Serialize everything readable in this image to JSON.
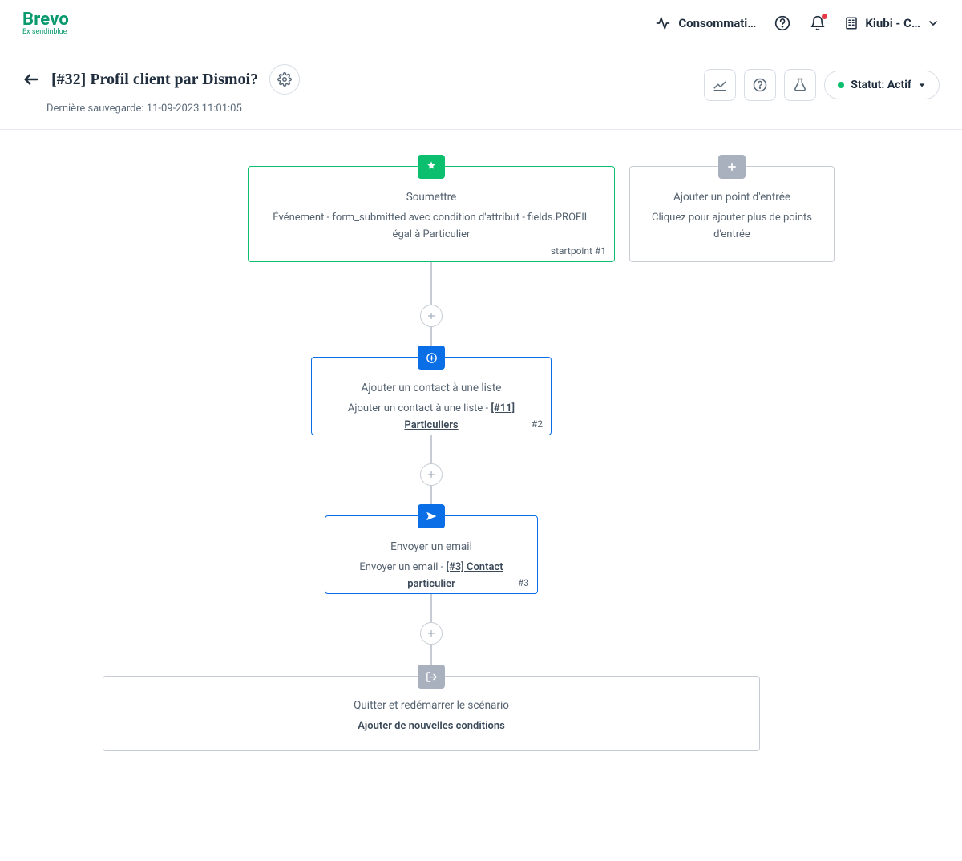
{
  "brand": {
    "name": "Brevo",
    "sub": "Ex sendinblue"
  },
  "topbar": {
    "usage": "Consommati…",
    "org": "Kiubi - C…"
  },
  "header": {
    "title": "[#32] Profil client par Dismoi?",
    "last_saved": "Dernière sauvegarde: 11-09-2023 11:01:05",
    "status_label": "Statut: Actif"
  },
  "nodes": {
    "start": {
      "title": "Soumettre",
      "body": "Événement - form_submitted avec condition d'attribut - fields.PROFIL égal à Particulier",
      "id": "startpoint #1"
    },
    "entry": {
      "title": "Ajouter un point d'entrée",
      "body": "Cliquez pour ajouter plus de points d'entrée"
    },
    "addlist": {
      "title": "Ajouter un contact à une liste",
      "body_prefix": "Ajouter un contact à une liste - ",
      "link": "[#11] Particuliers",
      "id": "#2"
    },
    "email": {
      "title": "Envoyer un email",
      "body_prefix": "Envoyer un email - ",
      "link": "[#3] Contact particulier",
      "id": "#3"
    },
    "exit": {
      "title": "Quitter et redémarrer le scénario",
      "link": "Ajouter de nouvelles conditions"
    }
  }
}
